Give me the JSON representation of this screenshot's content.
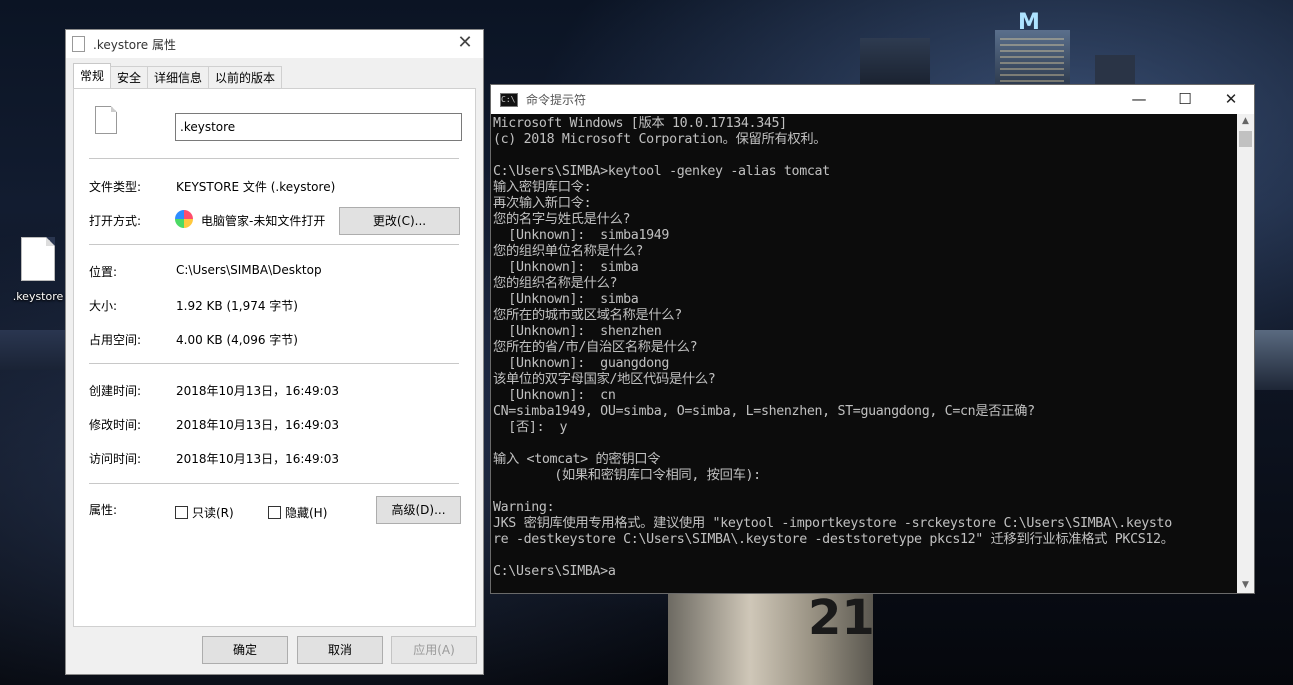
{
  "desktop": {
    "icon_label": ".keystore"
  },
  "properties_dialog": {
    "title": ".keystore 属性",
    "tabs": [
      {
        "label": "常规",
        "active": true
      },
      {
        "label": "安全",
        "active": false
      },
      {
        "label": "详细信息",
        "active": false
      },
      {
        "label": "以前的版本",
        "active": false
      }
    ],
    "file_name_value": ".keystore",
    "file_type_label": "文件类型:",
    "file_type_value": "KEYSTORE 文件 (.keystore)",
    "open_with_label": "打开方式:",
    "open_with_value": "电脑管家-未知文件打开",
    "change_button": "更改(C)...",
    "location_label": "位置:",
    "location_value": "C:\\Users\\SIMBA\\Desktop",
    "size_label": "大小:",
    "size_value": "1.92 KB (1,974 字节)",
    "size_on_disk_label": "占用空间:",
    "size_on_disk_value": "4.00 KB (4,096 字节)",
    "created_label": "创建时间:",
    "created_value": "2018年10月13日，16:49:03",
    "modified_label": "修改时间:",
    "modified_value": "2018年10月13日，16:49:03",
    "accessed_label": "访问时间:",
    "accessed_value": "2018年10月13日，16:49:03",
    "attributes_label": "属性:",
    "readonly_label": "只读(R)",
    "hidden_label": "隐藏(H)",
    "advanced_button": "高级(D)...",
    "ok_button": "确定",
    "cancel_button": "取消",
    "apply_button": "应用(A)"
  },
  "cmd_window": {
    "title": "命令提示符",
    "icon_text": "C:\\",
    "minimize": "—",
    "maximize": "☐",
    "close": "✕",
    "lines": [
      "Microsoft Windows [版本 10.0.17134.345]",
      "(c) 2018 Microsoft Corporation。保留所有权利。",
      "",
      "C:\\Users\\SIMBA>keytool -genkey -alias tomcat",
      "输入密钥库口令:",
      "再次输入新口令:",
      "您的名字与姓氏是什么?",
      "  [Unknown]:  simba1949",
      "您的组织单位名称是什么?",
      "  [Unknown]:  simba",
      "您的组织名称是什么?",
      "  [Unknown]:  simba",
      "您所在的城市或区域名称是什么?",
      "  [Unknown]:  shenzhen",
      "您所在的省/市/自治区名称是什么?",
      "  [Unknown]:  guangdong",
      "该单位的双字母国家/地区代码是什么?",
      "  [Unknown]:  cn",
      "CN=simba1949, OU=simba, O=simba, L=shenzhen, ST=guangdong, C=cn是否正确?",
      "  [否]:  y",
      "",
      "输入 <tomcat> 的密钥口令",
      "        (如果和密钥库口令相同, 按回车):",
      "",
      "Warning:",
      "JKS 密钥库使用专用格式。建议使用 \"keytool -importkeystore -srckeystore C:\\Users\\SIMBA\\.keysto",
      "re -destkeystore C:\\Users\\SIMBA\\.keystore -deststoretype pkcs12\" 迁移到行业标准格式 PKCS12。",
      "",
      "C:\\Users\\SIMBA>a"
    ]
  }
}
